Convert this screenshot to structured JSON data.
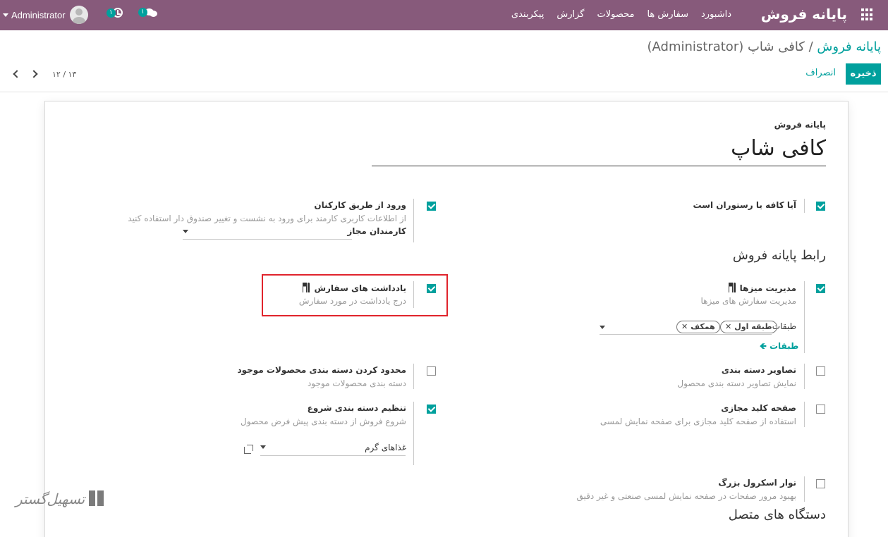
{
  "navbar": {
    "brand": "پایانه فروش",
    "menu": [
      "داشبورد",
      "سفارش ها",
      "محصولات",
      "گزارش",
      "پیکربندی"
    ],
    "activity_count": "۱",
    "message_count": "۱",
    "user": "Administrator",
    "bg_color": "#875a7b"
  },
  "control": {
    "breadcrumb_root": "پایانه فروش",
    "breadcrumb_sep": "/",
    "breadcrumb_current": "کافی شاپ (Administrator)",
    "save_label": "ذخیره",
    "discard_label": "انصراف",
    "pager": "۱۲ / ۱۳"
  },
  "form": {
    "label": "پایانه فروش",
    "name": "کافی شاپ",
    "is_restaurant": {
      "title": "آیا کافه یا رستوران است",
      "checked": true
    },
    "employee_login": {
      "title": "ورود از طریق کارکنان",
      "help": "از اطلاعات کاربری کارمند برای ورود به نشست و تغییر صندوق دار استفاده کنید",
      "field_label": "کارمندان مجاز",
      "checked": true
    },
    "section_pos": "رابط پایانه فروش",
    "table_management": {
      "title": "مدیریت میزها",
      "help": "مدیریت سفارش های میزها",
      "floors_label": "طبقات",
      "tags": [
        "طبقه اول",
        "همکف"
      ],
      "floors_link": "طبقات",
      "checked": true
    },
    "order_notes": {
      "title": "یادداشت های سفارش",
      "help": "درج یادداشت در مورد سفارش",
      "checked": true
    },
    "category_images": {
      "title": "تصاویر دسته بندی",
      "help": "نمایش تصاویر دسته بندی محصول",
      "checked": false
    },
    "restrict_categories": {
      "title": "محدود کردن دسته بندی محصولات موجود",
      "help": "دسته بندی محصولات موجود",
      "checked": false
    },
    "virtual_keyboard": {
      "title": "صفحه کلید مجازی",
      "help": "استفاده از صفحه کلید مجازی برای صفحه نمایش لمسی",
      "checked": false
    },
    "start_category": {
      "title": "تنظیم دسته بندی شروع",
      "help": "شروع فروش از دسته بندی پیش فرض محصول",
      "value": "غذاهای گرم",
      "checked": true
    },
    "large_scrollbar": {
      "title": "نوار اسکرول بزرگ",
      "help": "بهبود مرور صفحات در صفحه نمایش لمسی صنعتی و غیر دقیق",
      "checked": false
    },
    "section_devices": "دستگاه های متصل"
  },
  "watermark": "تسهیل‌گستر",
  "accent_color": "#00a09d"
}
